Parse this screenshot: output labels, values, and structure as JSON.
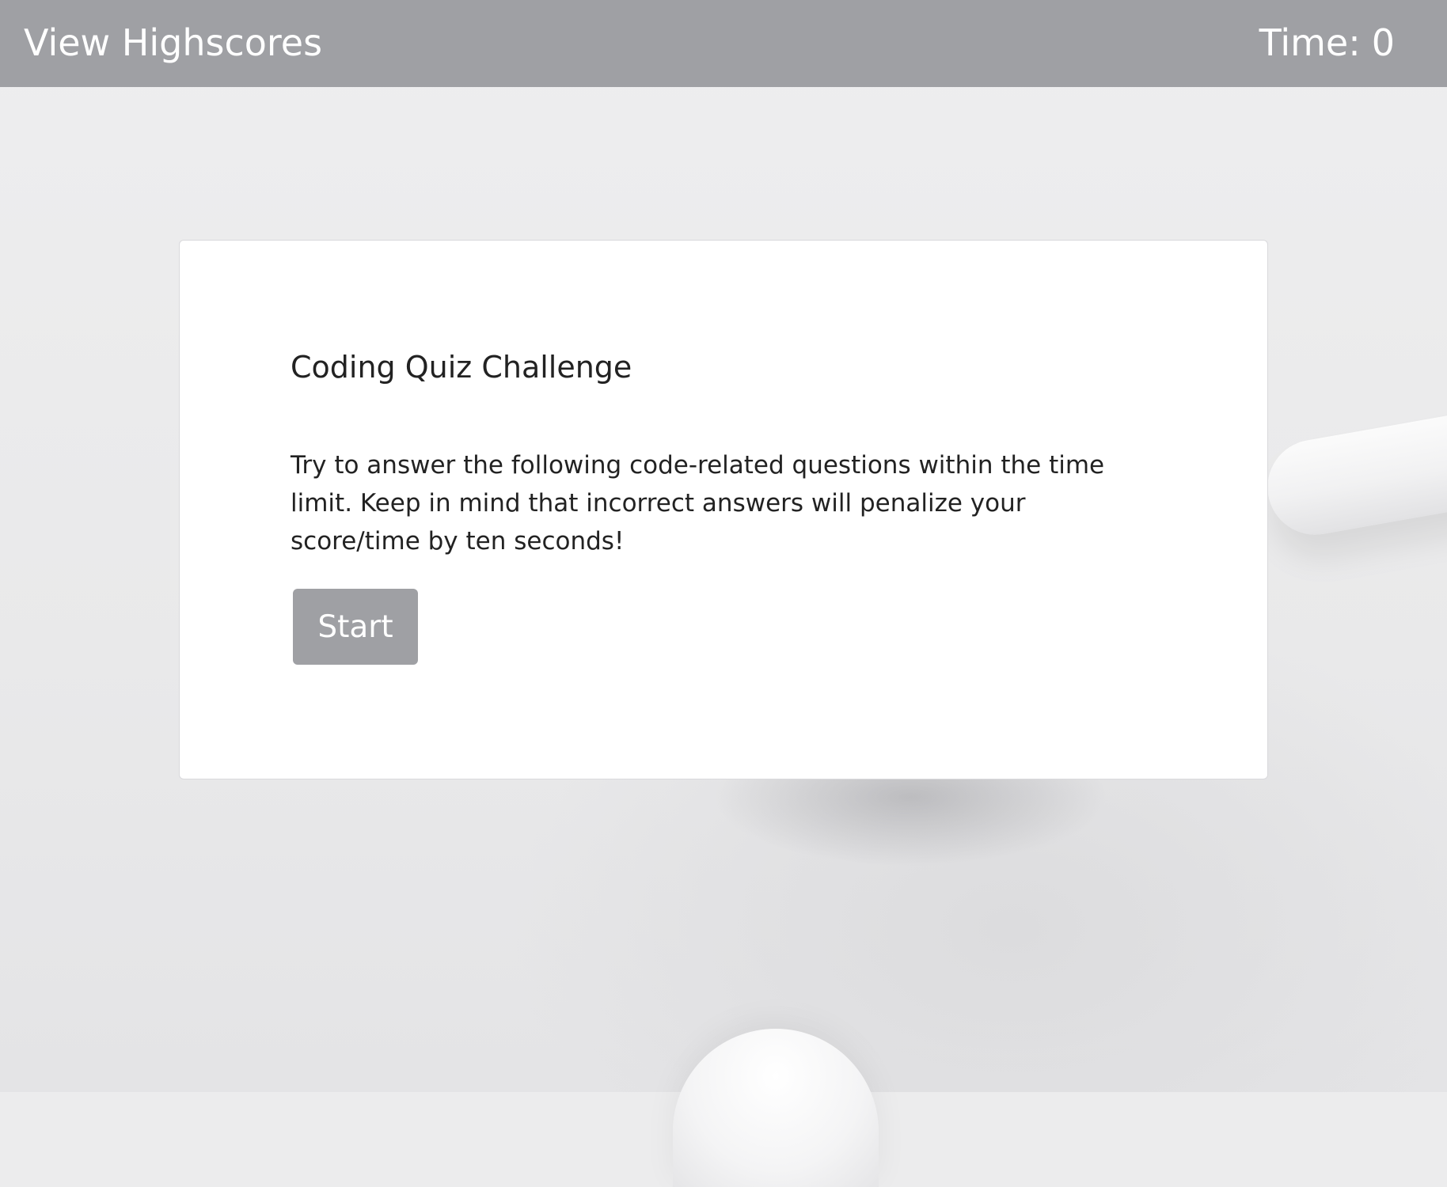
{
  "header": {
    "highscores_link": "View Highscores",
    "timer_label": "Time:",
    "timer_value": "0"
  },
  "quiz": {
    "title": "Coding Quiz Challenge",
    "description": "Try to answer the following code-related questions within the time limit. Keep in mind that incorrect answers will penalize your score/time by ten seconds!",
    "start_label": "Start"
  },
  "colors": {
    "topbar": "#9fa0a4",
    "button": "#9fa0a4",
    "card": "#ffffff",
    "text": "#222222"
  }
}
